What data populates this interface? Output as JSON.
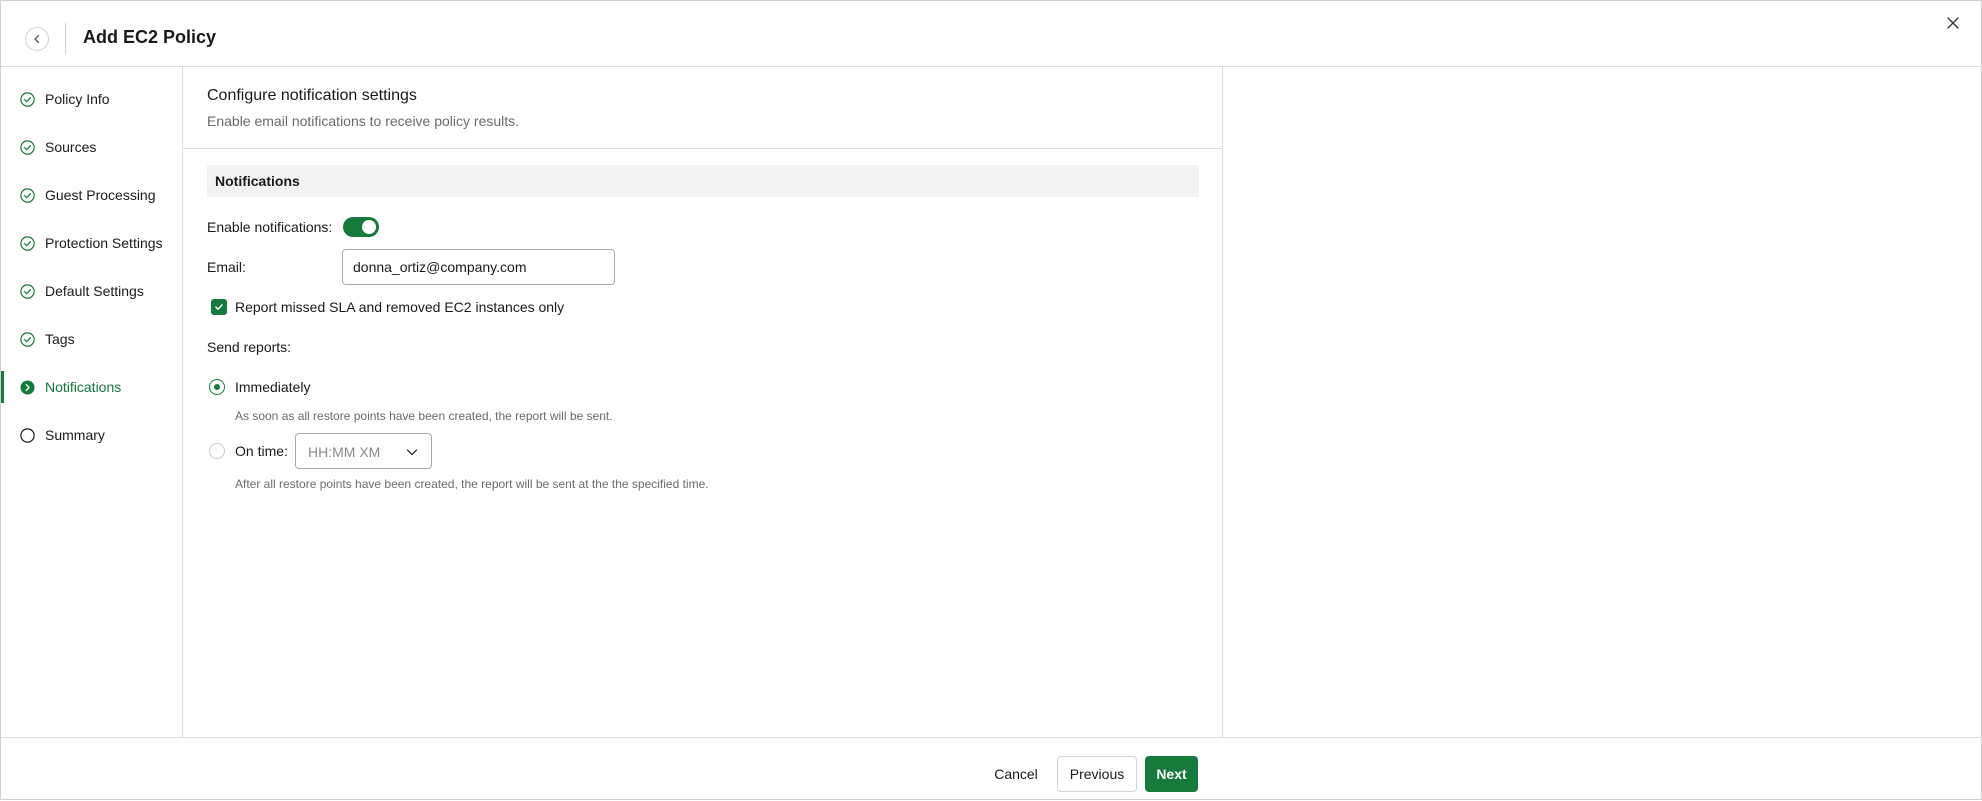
{
  "header": {
    "title": "Add EC2 Policy"
  },
  "sidebar": {
    "items": [
      {
        "label": "Policy Info",
        "state": "done"
      },
      {
        "label": "Sources",
        "state": "done"
      },
      {
        "label": "Guest Processing",
        "state": "done"
      },
      {
        "label": "Protection Settings",
        "state": "done"
      },
      {
        "label": "Default Settings",
        "state": "done"
      },
      {
        "label": "Tags",
        "state": "done"
      },
      {
        "label": "Notifications",
        "state": "active"
      },
      {
        "label": "Summary",
        "state": "pending"
      }
    ]
  },
  "main": {
    "title": "Configure notification settings",
    "subtitle": "Enable email notifications to receive policy results.",
    "group_title": "Notifications",
    "enable_label": "Enable notifications:",
    "enable_value": true,
    "email_label": "Email:",
    "email_value": "donna_ortiz@company.com",
    "report_checkbox_label": "Report missed SLA and removed EC2 instances only",
    "report_checkbox_checked": true,
    "send_reports_label": "Send reports:",
    "immediately_label": "Immediately",
    "immediately_hint": "As soon as all restore points have been created, the report will be sent.",
    "on_time_label": "On time:",
    "on_time_placeholder": "HH:MM XM",
    "on_time_hint": "After all restore points have been created, the report will be sent at the the specified time.",
    "selected_option": "immediately"
  },
  "footer": {
    "cancel_label": "Cancel",
    "previous_label": "Previous",
    "next_label": "Next"
  },
  "colors": {
    "accent": "#157a3c",
    "border": "#dcdcdc",
    "muted_text": "#6b6b6b"
  },
  "icons": {
    "back": "chevron-left-icon",
    "close": "close-icon",
    "done": "check-circle-icon",
    "active": "chevron-right-circle-icon",
    "pending": "empty-circle-icon",
    "dropdown": "chevron-down-icon"
  }
}
